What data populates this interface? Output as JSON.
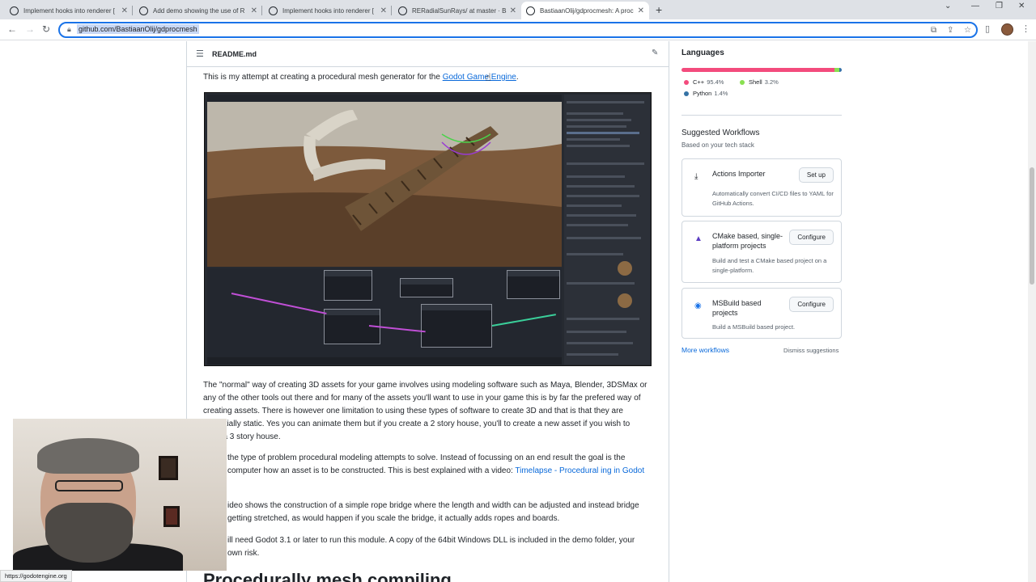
{
  "browser": {
    "tabs": [
      {
        "title": "Implement hooks into renderer ["
      },
      {
        "title": "Add demo showing the use of R"
      },
      {
        "title": "Implement hooks into renderer ["
      },
      {
        "title": "RERadialSunRays/ at master · Ba"
      },
      {
        "title": "BastiaanOlij/gdprocmesh: A proc"
      }
    ],
    "url": "github.com/BastiaanOlij/gdprocmesh",
    "status_url": "https://godotengine.org"
  },
  "readme": {
    "filename": "README.md",
    "intro_prefix": "This is my attempt at creating a procedural mesh generator for the ",
    "intro_link": "Godot Game Engine",
    "intro_suffix": ".",
    "para1": "The \"normal\" way of creating 3D assets for your game involves using modeling software such as Maya, Blender, 3DSMax or any of the other tools out there and for many of the assets you'll want to use in your game this is by far the prefered way of creating assets. There is however one limitation to using these types of software to create 3D and that is that they are essentially static. Yes you can animate them but if you create a 2 story house, you'll to create a new asset if you wish to have a 3 story house.",
    "para2_text": " the type of problem procedural modeling attempts to solve. Instead of focussing on an end result the goal is the computer how an asset is to be constructed. This is best explained with a video: ",
    "para2_link": "Timelapse - Procedural ing in Godot",
    "para3": "ideo shows the construction of a simple rope bridge where the length and width can be adjusted and instead bridge getting stretched, as would happen if you scale the bridge, it actually adds ropes and boards.",
    "para4": "ill need Godot 3.1 or later to run this module. A copy of the 64bit Windows DLL is included in the demo folder, your own risk.",
    "heading": "Procedurally mesh compiling"
  },
  "languages": {
    "title": "Languages",
    "items": [
      {
        "name": "C++",
        "pct": "95.4%",
        "color": "#f34b7d"
      },
      {
        "name": "Shell",
        "pct": "3.2%",
        "color": "#89e051"
      },
      {
        "name": "Python",
        "pct": "1.4%",
        "color": "#3572a5"
      }
    ]
  },
  "workflows": {
    "title": "Suggested Workflows",
    "subtitle": "Based on your tech stack",
    "items": [
      {
        "name": "Actions Importer",
        "desc": "Automatically convert CI/CD files to YAML for GitHub Actions.",
        "button": "Set up"
      },
      {
        "name": "CMake based, single-platform projects",
        "desc": "Build and test a CMake based project on a single-platform.",
        "button": "Configure"
      },
      {
        "name": "MSBuild based projects",
        "desc": "Build a MSBuild based project.",
        "button": "Configure"
      }
    ],
    "more": "More workflows",
    "dismiss": "Dismiss suggestions"
  }
}
